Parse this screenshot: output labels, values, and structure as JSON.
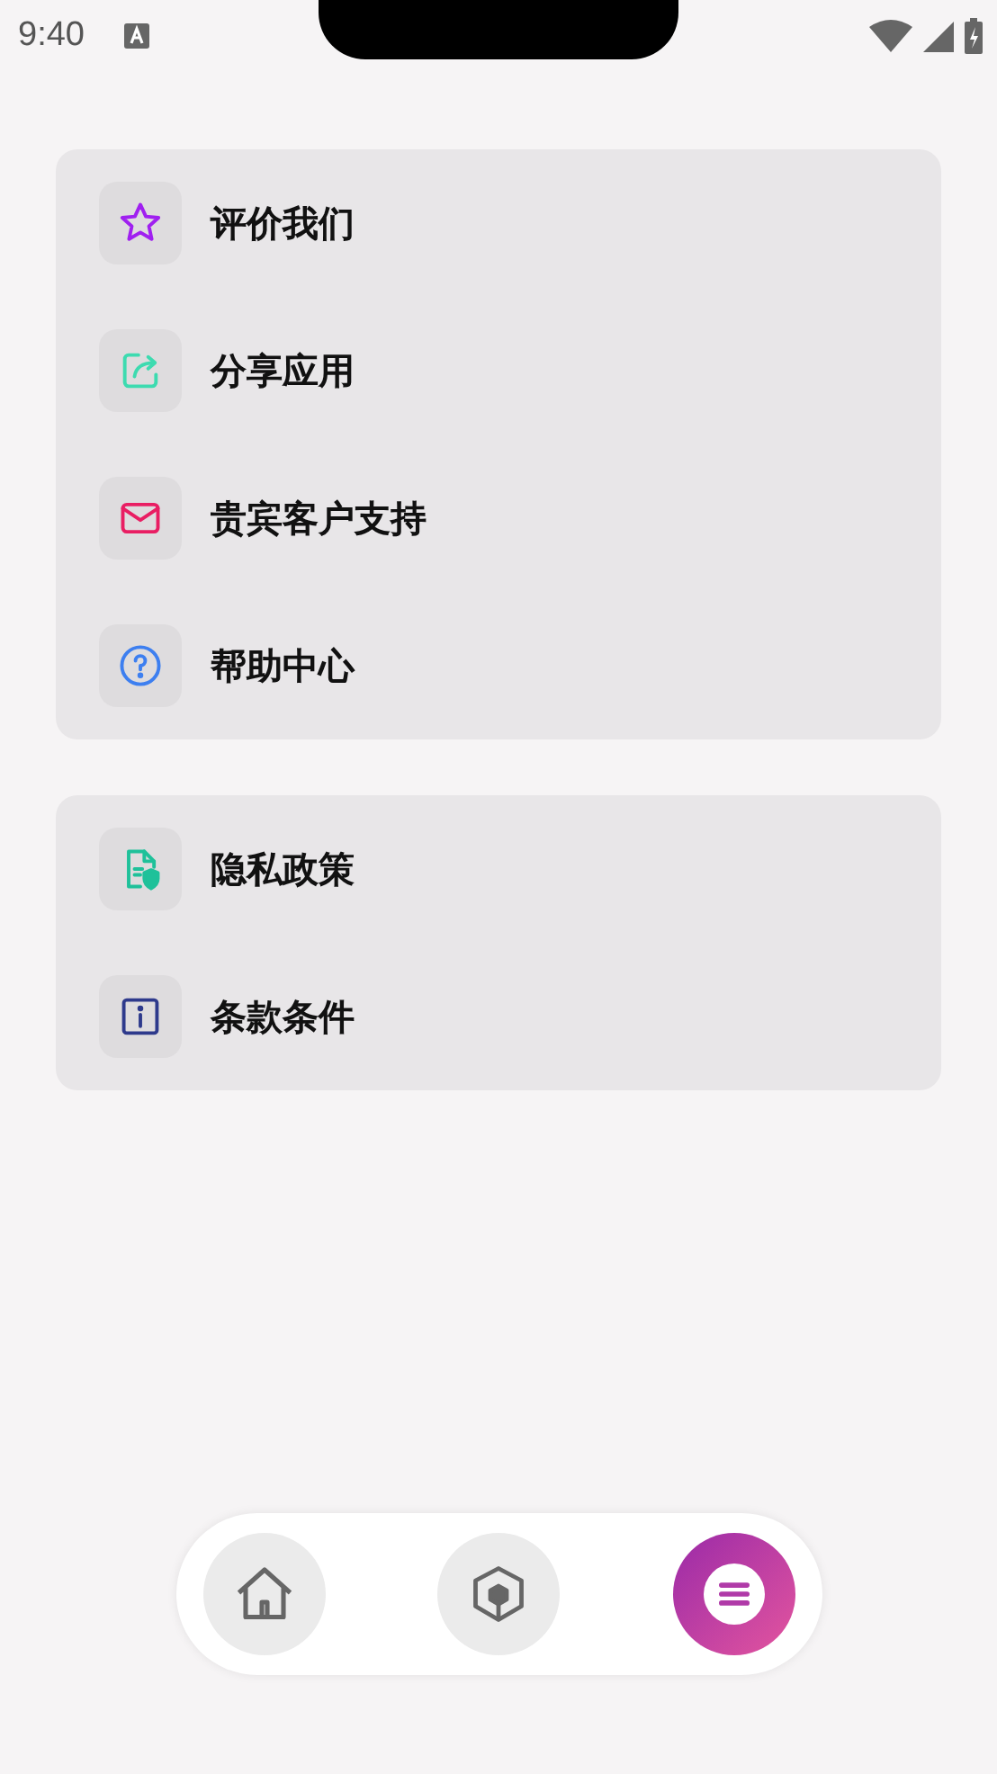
{
  "status_bar": {
    "time": "9:40"
  },
  "groups": [
    {
      "items": [
        {
          "label": "评价我们",
          "kind": "star",
          "color": "#a020f0"
        },
        {
          "label": "分享应用",
          "kind": "share",
          "color": "#3ddbb0"
        },
        {
          "label": "贵宾客户支持",
          "kind": "mail",
          "color": "#e91e63"
        },
        {
          "label": "帮助中心",
          "kind": "help",
          "color": "#3d7ff0"
        }
      ]
    },
    {
      "items": [
        {
          "label": "隐私政策",
          "kind": "privacy",
          "color": "#1fc19a"
        },
        {
          "label": "条款条件",
          "kind": "info",
          "color": "#2e3a8c"
        }
      ]
    }
  ],
  "nav": [
    {
      "kind": "home",
      "selected": false
    },
    {
      "kind": "cube",
      "selected": false
    },
    {
      "kind": "menu",
      "selected": true
    }
  ]
}
